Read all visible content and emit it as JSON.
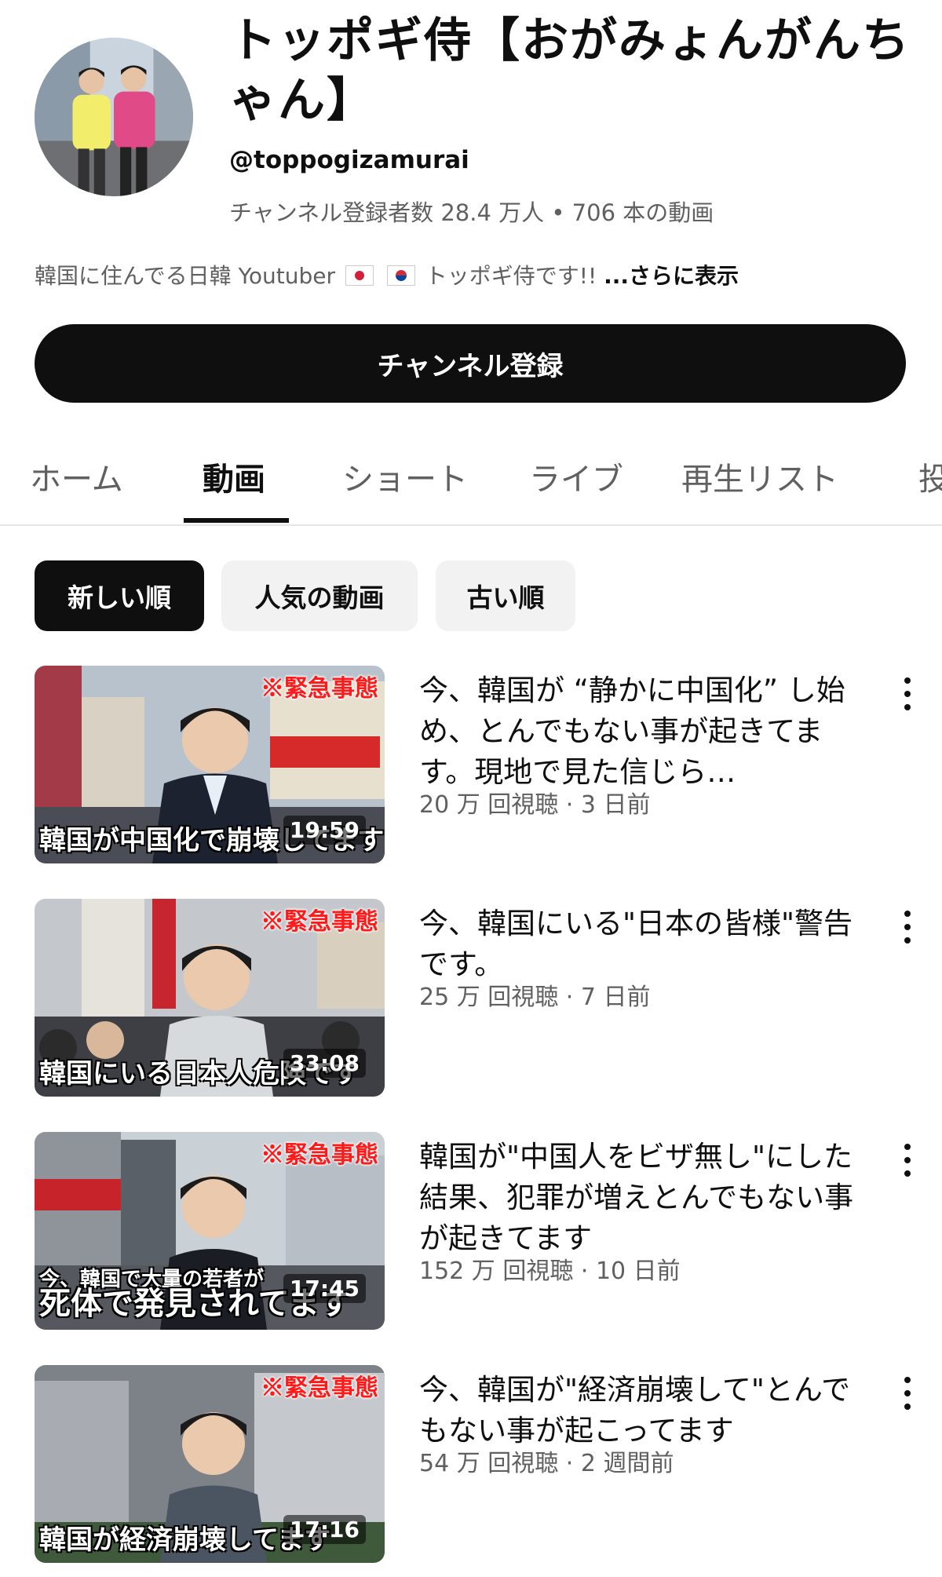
{
  "channel": {
    "name": "トッポギ侍【おがみょんがんちゃん】",
    "handle": "@toppogizamurai",
    "stats": "チャンネル登録者数 28.4 万人 • 706 本の動画",
    "description": "韓国に住んでる日韓 Youtuber",
    "description_tail": "トッポギ侍です!!",
    "more_label": "...さらに表示",
    "subscribe_label": "チャンネル登録"
  },
  "tabs": [
    {
      "label": "ホーム",
      "active": false
    },
    {
      "label": "動画",
      "active": true
    },
    {
      "label": "ショート",
      "active": false
    },
    {
      "label": "ライブ",
      "active": false
    },
    {
      "label": "再生リスト",
      "active": false
    },
    {
      "label": "投",
      "active": false
    }
  ],
  "filters": [
    {
      "label": "新しい順",
      "active": true
    },
    {
      "label": "人気の動画",
      "active": false
    },
    {
      "label": "古い順",
      "active": false
    }
  ],
  "videos": [
    {
      "title": "今、韓国が “静かに中国化” し始め、とんでもない事が起きてます。現地で見た信じら…",
      "meta": "20 万 回視聴 · 3 日前",
      "duration": "19:59",
      "badge": "※緊急事態",
      "caption": "韓国が中国化で崩壊してます"
    },
    {
      "title": "今、韓国にいる\"日本の皆様\"警告です。",
      "meta": "25 万 回視聴 · 7 日前",
      "duration": "33:08",
      "badge": "※緊急事態",
      "caption": "韓国にいる日本人危険です"
    },
    {
      "title": "韓国が\"中国人をビザ無し\"にした結果、犯罪が増えとんでもない事が起きてます",
      "meta": "152 万 回視聴 · 10 日前",
      "duration": "17:45",
      "badge": "※緊急事態",
      "caption_top": "今、韓国で大量の若者が",
      "caption": "死体で発見されてます"
    },
    {
      "title": "今、韓国が\"経済崩壊して\"とんでもない事が起こってます",
      "meta": "54 万 回視聴 · 2 週間前",
      "duration": "17:16",
      "badge": "※緊急事態",
      "caption": "韓国が経済崩壊してます"
    }
  ],
  "colors": {
    "accent": "#0f0f0f",
    "muted_text": "#606060",
    "chip_bg": "#f2f2f2",
    "badge_red": "#ff1a1a"
  }
}
